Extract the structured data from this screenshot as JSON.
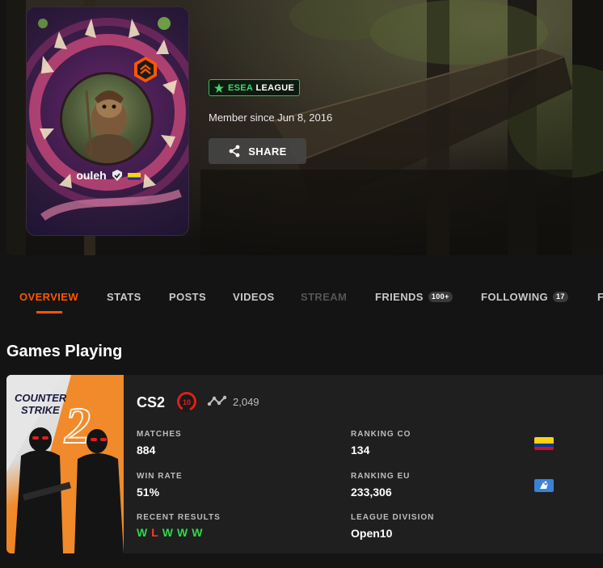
{
  "profile": {
    "nickname": "ouleh",
    "badge": {
      "prefix": "ESEA",
      "suffix": "LEAGUE"
    },
    "member_since": "Member since Jun 8, 2016",
    "share_label": "SHARE",
    "level_icon": "chevron-up-hex-icon",
    "verified_icon": "verified-shield-icon",
    "country": "Colombia"
  },
  "tabs": [
    {
      "label": "OVERVIEW",
      "active": true
    },
    {
      "label": "STATS"
    },
    {
      "label": "POSTS"
    },
    {
      "label": "VIDEOS"
    },
    {
      "label": "STREAM",
      "disabled": true
    },
    {
      "label": "FRIENDS",
      "count": "100+"
    },
    {
      "label": "FOLLOWING",
      "count": "17"
    },
    {
      "label": "F"
    }
  ],
  "games_section": {
    "title": "Games Playing",
    "game": {
      "art_title_line1": "COUNTER",
      "art_title_line2": "STRIKE",
      "art_number": "2",
      "name": "CS2",
      "level": "10",
      "elo": "2,049",
      "stats": {
        "matches_label": "MATCHES",
        "matches": "884",
        "win_rate_label": "WIN RATE",
        "win_rate": "51%",
        "recent_label": "RECENT RESULTS",
        "recent": [
          "W",
          "L",
          "W",
          "W",
          "W"
        ],
        "ranking_co_label": "RANKING CO",
        "ranking_co": "134",
        "ranking_eu_label": "RANKING EU",
        "ranking_eu": "233,306",
        "division_label": "LEAGUE DIVISION",
        "division": "Open10"
      }
    }
  },
  "colors": {
    "accent": "#ff5500",
    "win": "#32d74b",
    "loss": "#ff3b30",
    "esea_green": "#3fd96a",
    "level_red": "#e0201a"
  }
}
